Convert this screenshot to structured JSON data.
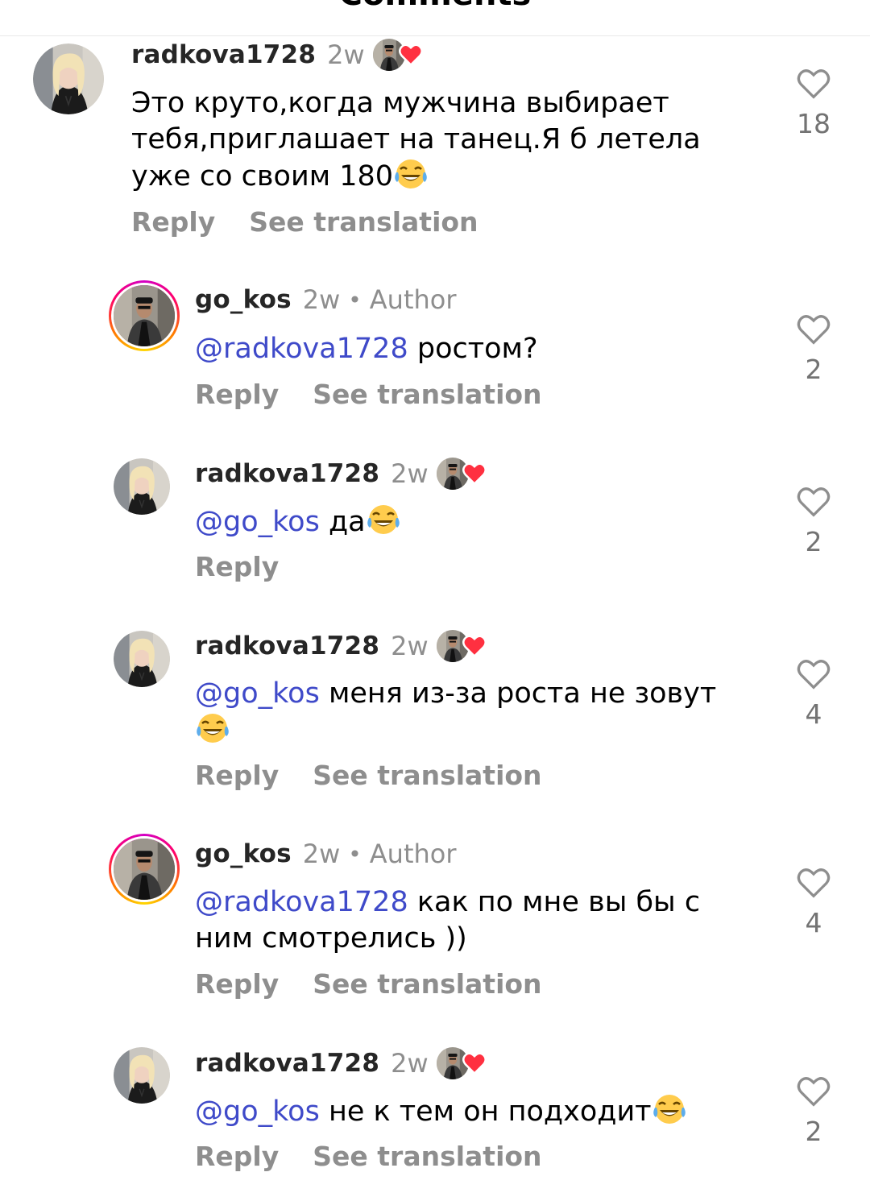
{
  "header": {
    "title": "Comments"
  },
  "comments": [
    {
      "username": "radkova1728",
      "time": "2w",
      "author": "",
      "mention": "",
      "text": "Это круто,когда мужчина выбирает тебя,приглашает на танец.Я б летела уже со своим 180",
      "emoji": "laughing-tears-emoji",
      "reply": "Reply",
      "translate": "See translation",
      "likes": "18",
      "creator_liked": true
    },
    {
      "username": "go_kos",
      "time": "2w",
      "author": "Author",
      "mention": "@radkova1728",
      "text": " ростом?",
      "emoji": "",
      "reply": "Reply",
      "translate": "See translation",
      "likes": "2",
      "creator_liked": false
    },
    {
      "username": "radkova1728",
      "time": "2w",
      "author": "",
      "mention": "@go_kos",
      "text": " да",
      "emoji": "laughing-tears-emoji",
      "reply": "Reply",
      "translate": "",
      "likes": "2",
      "creator_liked": true
    },
    {
      "username": "radkova1728",
      "time": "2w",
      "author": "",
      "mention": "@go_kos",
      "text": " меня из-за роста не зовут",
      "emoji": "laughing-tears-emoji",
      "reply": "Reply",
      "translate": "See translation",
      "likes": "4",
      "creator_liked": true
    },
    {
      "username": "go_kos",
      "time": "2w",
      "author": "Author",
      "mention": "@radkova1728",
      "text": " как по мне вы бы с ним смотрелись ))",
      "emoji": "",
      "reply": "Reply",
      "translate": "See translation",
      "likes": "4",
      "creator_liked": false
    },
    {
      "username": "radkova1728",
      "time": "2w",
      "author": "",
      "mention": "@go_kos",
      "text": " не к тем он подходит",
      "emoji": "laughing-tears-emoji",
      "reply": "Reply",
      "translate": "See translation",
      "likes": "2",
      "creator_liked": true
    }
  ],
  "icons": {
    "like": "heart-outline-icon",
    "creator_like": "heart-filled-icon",
    "emoji": "laughing-tears-emoji"
  },
  "colors": {
    "mention": "#3f4ac9",
    "muted": "#8e8e8e",
    "heart": "#ff3040"
  }
}
